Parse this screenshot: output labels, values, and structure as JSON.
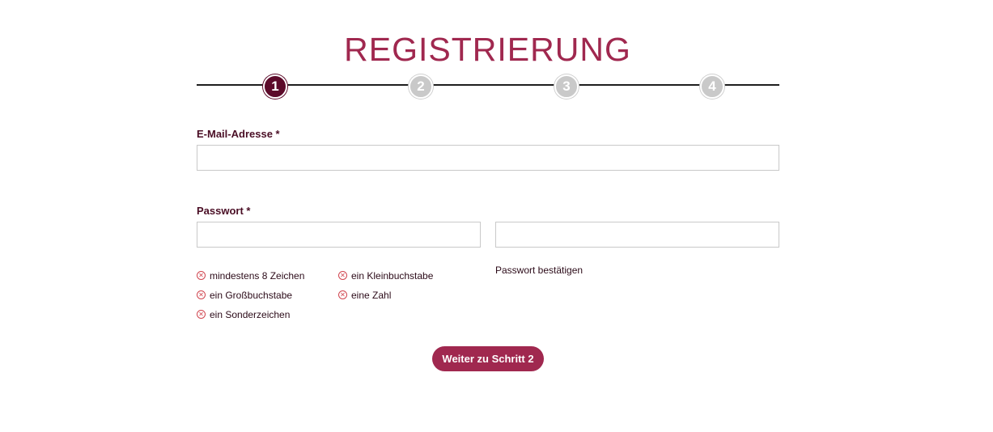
{
  "header": {
    "title": "REGISTRIERUNG"
  },
  "stepper": {
    "steps": [
      "1",
      "2",
      "3",
      "4"
    ],
    "current_step": 1,
    "active_color": "#5c0a2a",
    "inactive_color": "#c9c9c9"
  },
  "form": {
    "email_label": "E-Mail-Adresse *",
    "email_value": "",
    "password_label": "Passwort *",
    "password_value": "",
    "password_confirm_value": "",
    "password_confirm_label": "Passwort bestätigen",
    "requirements": [
      {
        "text": "mindestens 8 Zeichen",
        "met": false
      },
      {
        "text": "ein Kleinbuchstabe",
        "met": false
      },
      {
        "text": "ein Großbuchstabe",
        "met": false
      },
      {
        "text": "eine Zahl",
        "met": false
      },
      {
        "text": "ein Sonderzeichen",
        "met": false
      }
    ],
    "requirement_icon": "circle-x-icon",
    "submit_label": "Weiter zu Schritt 2"
  },
  "colors": {
    "accent": "#a0284f",
    "label": "#4a0e25",
    "error": "#d0454f"
  }
}
